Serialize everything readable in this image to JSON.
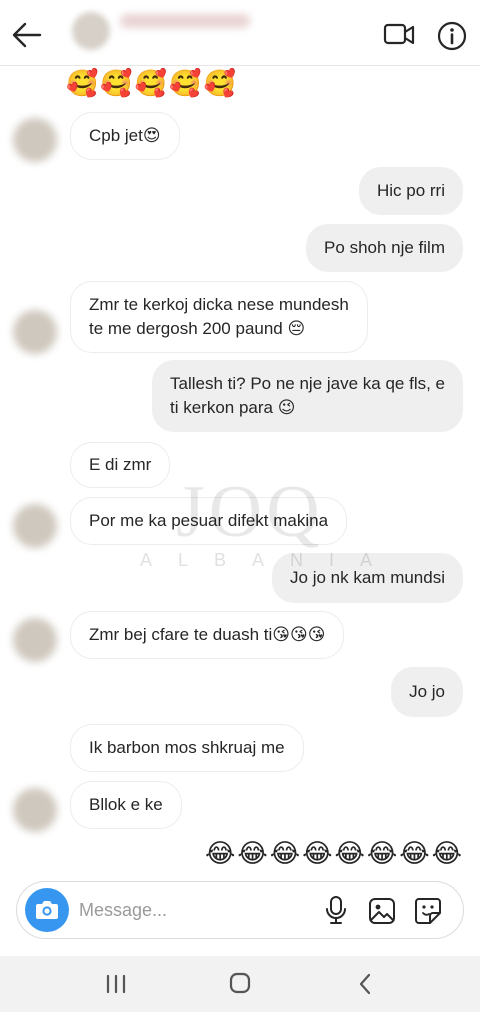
{
  "header": {
    "contact_name": "",
    "back_icon": "arrow-left-icon",
    "video_icon": "video-camera-icon",
    "info_icon": "info-icon"
  },
  "messages": [
    {
      "id": "m0",
      "side": "in",
      "kind": "emoji",
      "text": "🥰🥰🥰🥰🥰"
    },
    {
      "id": "m1",
      "side": "in",
      "text": "Cpb jet😍"
    },
    {
      "id": "m2",
      "side": "out",
      "text": "Hic po rri"
    },
    {
      "id": "m3",
      "side": "out",
      "text": "Po shoh nje film"
    },
    {
      "id": "m4",
      "side": "in",
      "text": "Zmr te kerkoj dicka nese mundesh\nte me dergosh 200 paund 😔"
    },
    {
      "id": "m5",
      "side": "out",
      "text": "Tallesh ti? Po ne nje jave ka qe fls, e\nti kerkon para 😉"
    },
    {
      "id": "m6",
      "side": "in",
      "text": "E di zmr"
    },
    {
      "id": "m7",
      "side": "in",
      "text": "Por me ka pesuar difekt makina"
    },
    {
      "id": "m8",
      "side": "out",
      "text": "Jo jo nk kam mundsi"
    },
    {
      "id": "m9",
      "side": "in",
      "text": "Zmr bej cfare te duash ti😘😘😘"
    },
    {
      "id": "m10",
      "side": "out",
      "text": "Jo jo"
    },
    {
      "id": "m11",
      "side": "in",
      "text": "Ik barbon mos shkruaj me"
    },
    {
      "id": "m12",
      "side": "in",
      "text": "Bllok e ke"
    },
    {
      "id": "m13",
      "side": "out",
      "kind": "emoji",
      "text": "😂😂😂😂😂😂😂😂"
    }
  ],
  "watermark": {
    "logo": "JOQ",
    "text": "ALBANIA"
  },
  "composer": {
    "placeholder": "Message...",
    "value": "",
    "camera_icon": "camera-icon",
    "mic_icon": "microphone-icon",
    "gallery_icon": "gallery-icon",
    "sticker_icon": "sticker-icon"
  },
  "navbar": {
    "recents_icon": "recents-icon",
    "home_icon": "home-icon",
    "back_icon": "back-icon"
  },
  "colors": {
    "accent": "#3797f0",
    "outgoing_bubble": "#efefef",
    "incoming_border": "#ececec"
  }
}
